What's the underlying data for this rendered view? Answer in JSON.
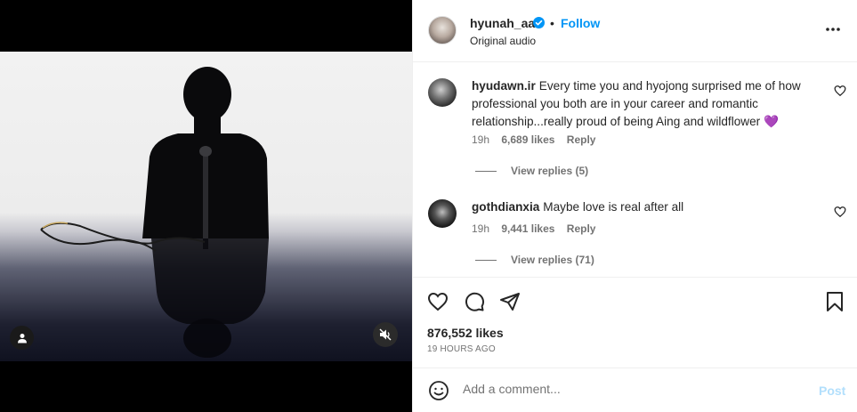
{
  "post": {
    "username": "hyunah_aa",
    "separator": "•",
    "follow_label": "Follow",
    "audio_label": "Original audio"
  },
  "comments": [
    {
      "username": "hyudawn.ir",
      "text": "Every time you and hyojong surprised me of how professional you both are in your career and romantic relationship...really proud of being Aing and wildflower",
      "emoji": "💜",
      "time": "19h",
      "likes": "6,689 likes",
      "reply": "Reply",
      "view_replies": "View replies (5)"
    },
    {
      "username": "gothdianxia",
      "text": "Maybe love is real after all",
      "time": "19h",
      "likes": "9,441 likes",
      "reply": "Reply",
      "view_replies": "View replies (71)"
    }
  ],
  "stats": {
    "likes": "876,552 likes",
    "time_ago": "19 HOURS AGO"
  },
  "composer": {
    "placeholder": "Add a comment...",
    "post_label": "Post"
  },
  "icons": {
    "verified": "verified-badge-icon",
    "more": "more-options-icon",
    "heart": "heart-icon",
    "comment": "comment-icon",
    "share": "share-icon",
    "save": "bookmark-icon",
    "emoji": "emoji-icon",
    "user_tag": "user-tag-icon",
    "mute": "muted-speaker-icon"
  },
  "colors": {
    "accent": "#0095f6",
    "post_disabled": "#b2dffc",
    "text_primary": "#262626",
    "text_secondary": "#737373",
    "verified": "#0095f6"
  }
}
